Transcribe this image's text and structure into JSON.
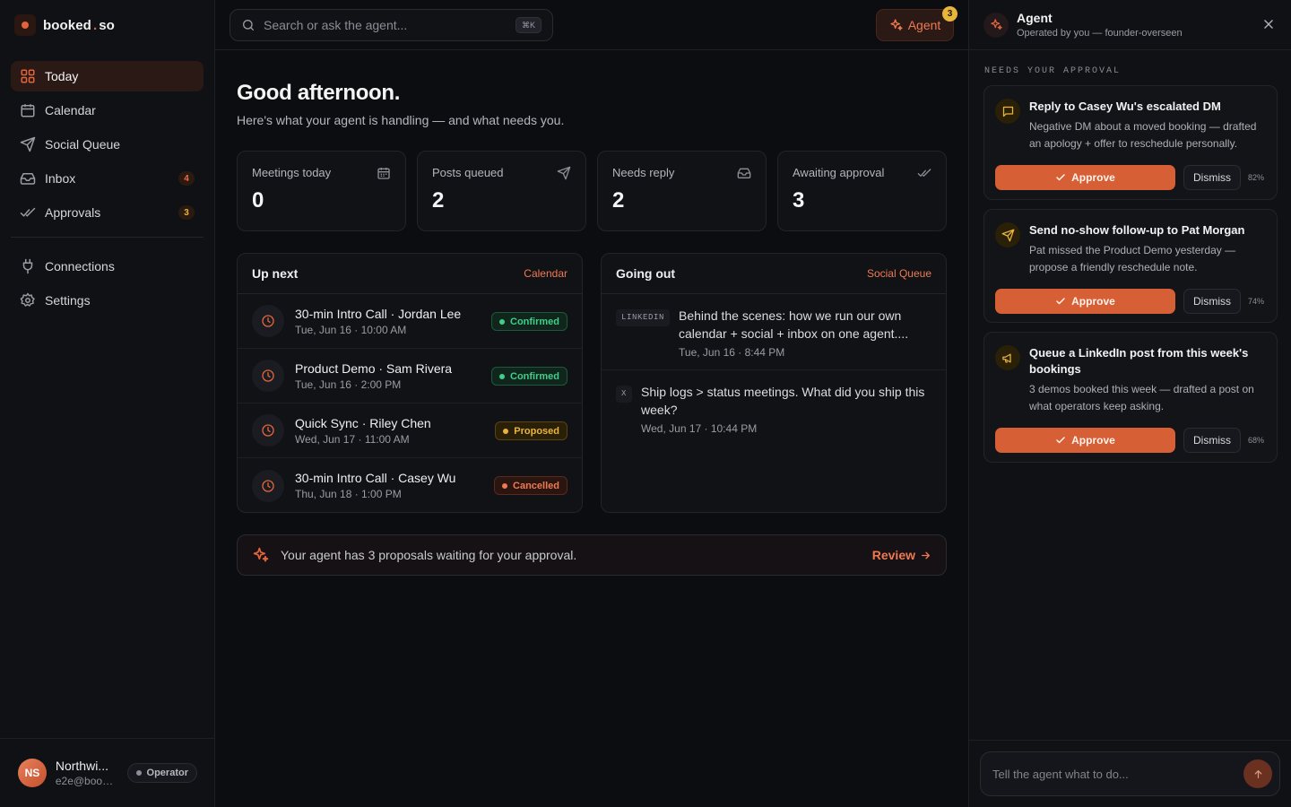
{
  "brand": {
    "name_left": "booked",
    "name_dot": ".",
    "name_right": "so",
    "accent": "#e0643c"
  },
  "sidebar": {
    "items": [
      {
        "label": "Today",
        "icon": "grid-icon",
        "active": true
      },
      {
        "label": "Calendar",
        "icon": "calendar-icon"
      },
      {
        "label": "Social Queue",
        "icon": "send-icon"
      },
      {
        "label": "Inbox",
        "icon": "inbox-icon",
        "badge": "4"
      },
      {
        "label": "Approvals",
        "icon": "check-double-icon",
        "badge": "3"
      }
    ],
    "secondary": [
      {
        "label": "Connections",
        "icon": "plug-icon"
      },
      {
        "label": "Settings",
        "icon": "gear-icon"
      }
    ]
  },
  "user": {
    "initials": "NS",
    "name": "Northwi...",
    "email": "e2e@book...",
    "role": "Operator"
  },
  "topbar": {
    "search_placeholder": "Search or ask the agent...",
    "shortcut": "⌘K",
    "agent_label": "Agent",
    "agent_badge": "3"
  },
  "main": {
    "greeting": "Good afternoon.",
    "subtitle": "Here's what your agent is handling — and what needs you.",
    "stats": [
      {
        "label": "Meetings today",
        "value": "0",
        "icon": "calendar-icon"
      },
      {
        "label": "Posts queued",
        "value": "2",
        "icon": "send-icon"
      },
      {
        "label": "Needs reply",
        "value": "2",
        "icon": "inbox-icon"
      },
      {
        "label": "Awaiting approval",
        "value": "3",
        "icon": "check-double-icon"
      }
    ],
    "up_next": {
      "title": "Up next",
      "link": "Calendar",
      "events": [
        {
          "title": "30-min Intro Call · Jordan Lee",
          "time": "Tue, Jun 16 · 10:00 AM",
          "status": "Confirmed"
        },
        {
          "title": "Product Demo · Sam Rivera",
          "time": "Tue, Jun 16 · 2:00 PM",
          "status": "Confirmed"
        },
        {
          "title": "Quick Sync · Riley Chen",
          "time": "Wed, Jun 17 · 11:00 AM",
          "status": "Proposed"
        },
        {
          "title": "30-min Intro Call · Casey Wu",
          "time": "Thu, Jun 18 · 1:00 PM",
          "status": "Cancelled"
        }
      ]
    },
    "going_out": {
      "title": "Going out",
      "link": "Social Queue",
      "posts": [
        {
          "network": "LINKEDIN",
          "text": "Behind the scenes: how we run our own calendar + social + inbox on one agent....",
          "time": "Tue, Jun 16 · 8:44 PM"
        },
        {
          "network": "X",
          "text": "Ship logs > status meetings. What did you ship this week?",
          "time": "Wed, Jun 17 · 10:44 PM"
        }
      ]
    },
    "banner": {
      "text": "Your agent has 3 proposals waiting for your approval.",
      "link": "Review"
    }
  },
  "agent": {
    "title": "Agent",
    "subtitle": "Operated by you — founder-overseen",
    "section": "NEEDS YOUR APPROVAL",
    "approve_label": "Approve",
    "dismiss_label": "Dismiss",
    "proposals": [
      {
        "title": "Reply to Casey Wu's escalated DM",
        "desc": "Negative DM about a moved booking — drafted an apology + offer to reschedule personally.",
        "confidence": "82%",
        "icon": "message-icon"
      },
      {
        "title": "Send no-show follow-up to Pat Morgan",
        "desc": "Pat missed the Product Demo yesterday — propose a friendly reschedule note.",
        "confidence": "74%",
        "icon": "send-icon"
      },
      {
        "title": "Queue a LinkedIn post from this week's bookings",
        "desc": "3 demos booked this week — drafted a post on what operators keep asking.",
        "confidence": "68%",
        "icon": "megaphone-icon"
      }
    ],
    "composer_placeholder": "Tell the agent what to do..."
  }
}
